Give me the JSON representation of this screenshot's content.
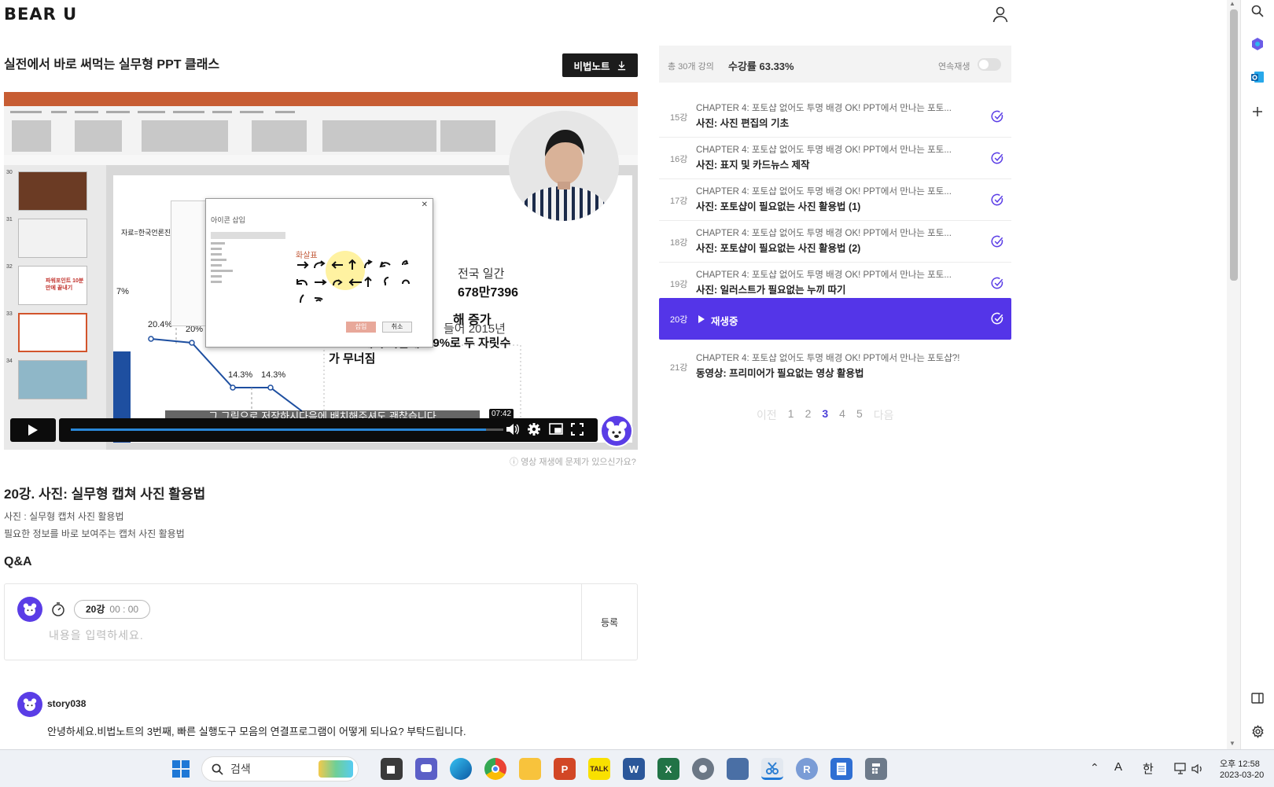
{
  "header": {
    "logo": "BEAR U"
  },
  "course": {
    "title": "실전에서 바로 써먹는 실무형 PPT 클래스",
    "note_button": "비법노트"
  },
  "video": {
    "subtitle": "그 그림으로 저장하시다음에 배치해주셔도 괜찮습니다",
    "time_tooltip": "07:42",
    "progress": 0.96,
    "help_text": "영상 재생에 문제가 있으신가요?",
    "dialog_title": "아이콘 삽입",
    "dialog_category": "화살표",
    "dialog_insert": "삽입",
    "dialog_cancel": "취소",
    "slide_source": "자료=한국언론진흥",
    "slide_pcts": [
      "20.4%",
      "20%",
      "14.3%",
      "14.3%",
      "7%"
    ],
    "slide_text1": "전국 일간",
    "slide_text2": "678만7396",
    "slide_text3": "해 증가",
    "slide_text4": "14.3%에서 지난해 9.9%로 두 자릿수",
    "slide_text5": "가 무너짐",
    "slide_text6": "들어 2015년",
    "thumb_nums": [
      "30",
      "31",
      "32",
      "33",
      "34"
    ],
    "thumb_caption": "파워포인트 10분만에 끝내기"
  },
  "lecture": {
    "title": "20강. 사진: 실무형 캡쳐 사진 활용법",
    "desc1": "사진 : 실무형 캡처 사진 활용법",
    "desc2": "필요한 정보를 바로 보여주는 캡처 사진 활용법"
  },
  "qa": {
    "heading": "Q&A",
    "timestamp_lecture": "20강",
    "timestamp_time": "00 : 00",
    "placeholder": "내용을 입력하세요.",
    "submit": "등록",
    "comment": {
      "user": "story038",
      "text": "안녕하세요.비법노트의 3번째, 빠른 실행도구 모음의 연결프로그램이 어떻게 되나요? 부탁드립니다."
    }
  },
  "panel": {
    "total": "총 30개 강의",
    "rate": "수강률 63.33%",
    "autoplay_label": "연속재생",
    "autoplay_on": false,
    "items": [
      {
        "num": "15강",
        "chapter": "CHAPTER 4: 포토샵 없어도 투명 배경 OK! PPT에서 만나는 포토...",
        "name": "사진: 사진 편집의 기초"
      },
      {
        "num": "16강",
        "chapter": "CHAPTER 4: 포토샵 없어도 투명 배경 OK! PPT에서 만나는 포토...",
        "name": "사진: 표지 및 카드뉴스 제작"
      },
      {
        "num": "17강",
        "chapter": "CHAPTER 4: 포토샵 없어도 투명 배경 OK! PPT에서 만나는 포토...",
        "name": "사진: 포토샵이 필요없는 사진 활용법 (1)"
      },
      {
        "num": "18강",
        "chapter": "CHAPTER 4: 포토샵 없어도 투명 배경 OK! PPT에서 만나는 포토...",
        "name": "사진: 포토샵이 필요없는 사진 활용법 (2)"
      },
      {
        "num": "19강",
        "chapter": "CHAPTER 4: 포토샵 없어도 투명 배경 OK! PPT에서 만나는 포토...",
        "name": "사진: 일러스트가 필요없는 누끼 따기"
      },
      {
        "num": "20강",
        "name": "재생중"
      },
      {
        "num": "21강",
        "chapter": "CHAPTER 4: 포토샵 없어도 투명 배경 OK! PPT에서 만나는 포토샵?!",
        "name": "동영상: 프리미어가 필요없는 영상 활용법"
      }
    ],
    "pager": {
      "prev": "이전",
      "pages": [
        "1",
        "2",
        "3",
        "4",
        "5"
      ],
      "current": "3",
      "next": "다음"
    }
  },
  "taskbar": {
    "search": "검색",
    "ime_a": "A",
    "ime_han": "한",
    "time": "오후 12:58",
    "date": "2023-03-20"
  },
  "colors": {
    "accent": "#5435e8",
    "check": "#5a3de6",
    "dark_button": "#1c1c1c"
  }
}
